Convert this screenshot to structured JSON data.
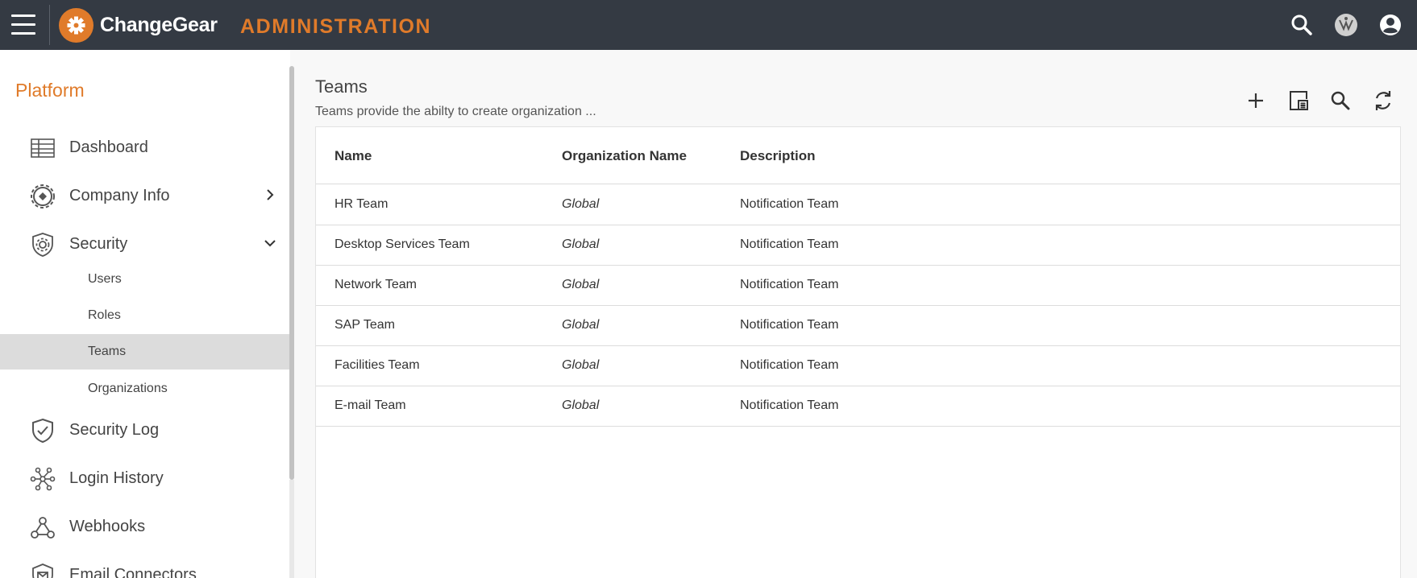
{
  "header": {
    "brand": "ChangeGear",
    "title": "ADMINISTRATION",
    "icons": [
      "menu-icon",
      "logo-gear-icon",
      "search-icon",
      "tenant-logo-icon",
      "user-account-icon"
    ],
    "accent": "#e07b2a",
    "bg": "#343a43"
  },
  "sidebar": {
    "section": "Platform",
    "items": [
      {
        "label": "Dashboard",
        "icon": "table-icon"
      },
      {
        "label": "Company Info",
        "icon": "company-gear-icon",
        "chevron": "chevron-right-icon"
      },
      {
        "label": "Security",
        "icon": "shield-gear-icon",
        "chevron": "chevron-down-icon"
      },
      {
        "label": "Security Log",
        "icon": "shield-check-icon"
      },
      {
        "label": "Login History",
        "icon": "network-icon"
      },
      {
        "label": "Webhooks",
        "icon": "webhook-icon"
      },
      {
        "label": "Email Connectors",
        "icon": "email-connector-icon"
      }
    ],
    "security_sub": [
      {
        "label": "Users"
      },
      {
        "label": "Roles"
      },
      {
        "label": "Teams",
        "active": true
      },
      {
        "label": "Organizations"
      }
    ]
  },
  "main": {
    "title": "Teams",
    "description": "Teams provide the abilty to create organization ...",
    "toolbar": [
      "add-icon",
      "export-icon",
      "search-icon",
      "refresh-icon"
    ],
    "table": {
      "columns": [
        "Name",
        "Organization Name",
        "Description"
      ],
      "rows": [
        [
          "HR Team",
          "Global",
          "Notification Team"
        ],
        [
          "Desktop Services Team",
          "Global",
          "Notification Team"
        ],
        [
          "Network Team",
          "Global",
          "Notification Team"
        ],
        [
          "SAP Team",
          "Global",
          "Notification Team"
        ],
        [
          "Facilities Team",
          "Global",
          "Notification Team"
        ],
        [
          "E-mail Team",
          "Global",
          "Notification Team"
        ]
      ]
    }
  }
}
